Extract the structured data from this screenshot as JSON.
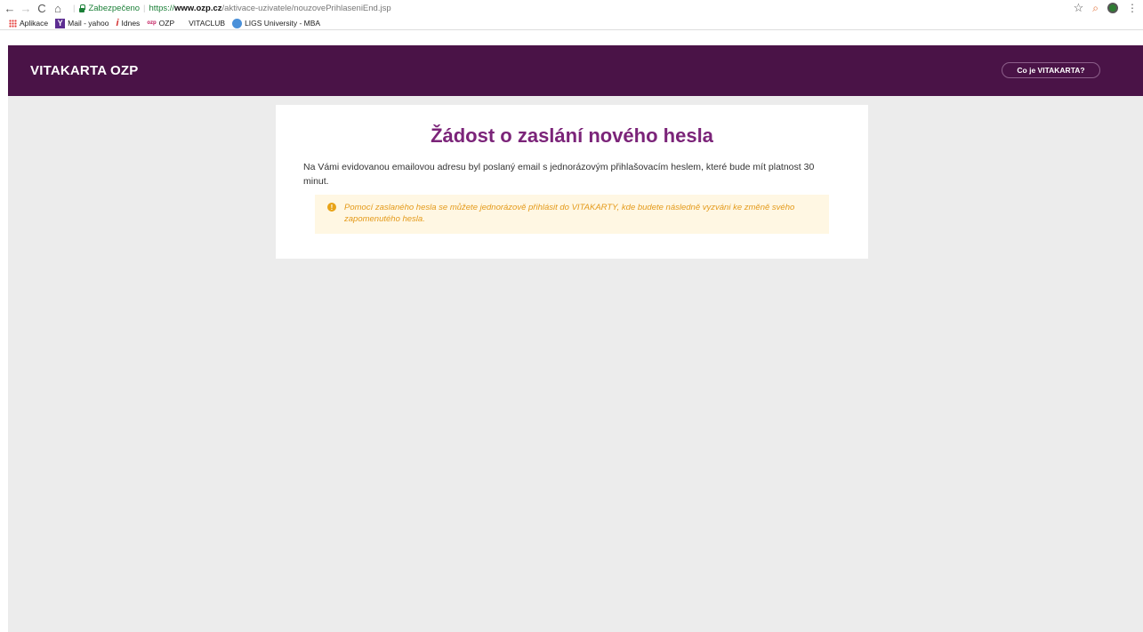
{
  "browser": {
    "secure_label": "Zabezpečeno",
    "url_scheme": "https://",
    "url_host": "www.ozp.cz",
    "url_path": "/aktivace-uzivatele/nouzovePrihlaseniEnd.jsp",
    "bookmarks": [
      {
        "label": "Aplikace"
      },
      {
        "label": "Mail - yahoo"
      },
      {
        "label": "Idnes"
      },
      {
        "label": "OZP"
      },
      {
        "label": "VITACLUB"
      },
      {
        "label": "LIGS University - MBA"
      }
    ]
  },
  "header": {
    "logo": "VITAKARTA OZP",
    "what_button": "Co je VITAKARTA?"
  },
  "card": {
    "title": "Žádost o zaslání nového hesla",
    "text": "Na Vámi evidovanou emailovou adresu byl poslaný email s jednorázovým přihlašovacím heslem, které bude mít platnost 30 minut.",
    "alert_icon": "!",
    "alert_text": "Pomocí zaslaného hesla se můžete jednorázově přihlásit do VITAKARTY, kde budete následně vyzváni ke změně svého zapomenutého hesla."
  },
  "colors": {
    "header_bg": "#4a1347",
    "title": "#7b2479",
    "alert_bg": "#fff7e3",
    "alert_text": "#e49a1a",
    "page_bg": "#ececec"
  }
}
